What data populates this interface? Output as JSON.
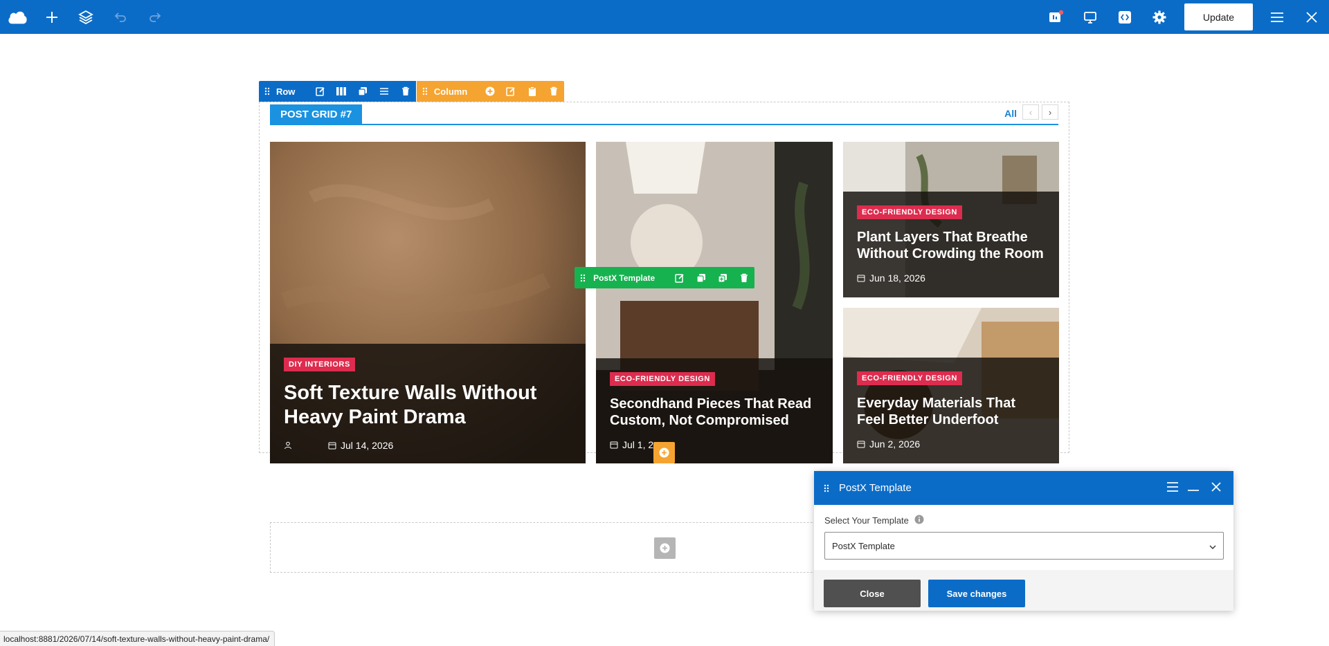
{
  "topbar": {
    "update_label": "Update",
    "icons": [
      "cloud-logo-icon",
      "plus-icon",
      "layers-icon",
      "undo-icon",
      "redo-icon",
      "notification-icon",
      "desktop-icon",
      "code-icon",
      "gear-icon",
      "menu-icon",
      "close-icon"
    ]
  },
  "row_toolbar": {
    "label": "Row"
  },
  "column_toolbar": {
    "label": "Column"
  },
  "post_grid": {
    "heading": "POST GRID #7",
    "all_link": "All",
    "prev": "‹",
    "next": "›",
    "cards": [
      {
        "category": "DIY INTERIORS",
        "title": "Soft Texture Walls Without Heavy Paint Drama",
        "date": "Jul 14, 2026"
      },
      {
        "category": "ECO-FRIENDLY DESIGN",
        "title": "Secondhand Pieces That Read Custom, Not Compromised",
        "date": "Jul 1, 2"
      },
      {
        "category": "ECO-FRIENDLY DESIGN",
        "title": "Plant Layers That Breathe Without Crowding the Room",
        "date": "Jun 18, 2026"
      },
      {
        "category": "ECO-FRIENDLY DESIGN",
        "title": "Everyday Materials That Feel Better Underfoot",
        "date": "Jun 2, 2026"
      }
    ]
  },
  "postx_toolbar": {
    "label": "PostX Template"
  },
  "panel": {
    "title": "PostX Template",
    "field_label": "Select Your Template",
    "selected_template": "PostX Template",
    "close_label": "Close",
    "save_label": "Save changes"
  },
  "status_bar": {
    "url": "localhost:8881/2026/07/14/soft-texture-walls-without-heavy-paint-drama/"
  },
  "colors": {
    "brand_blue": "#0b6cc8",
    "column_orange": "#f5a431",
    "template_green": "#16b24f",
    "category_red": "#dd2c4e",
    "heading_blue": "#1a92e0"
  }
}
